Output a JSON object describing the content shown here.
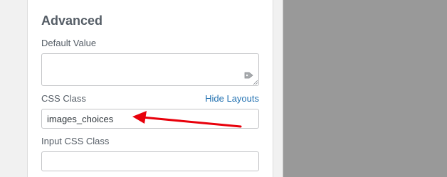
{
  "advanced": {
    "title": "Advanced",
    "default_value": {
      "label": "Default Value",
      "value": "",
      "icon": "tag-icon"
    },
    "css_class": {
      "label": "CSS Class",
      "value": "images_choices",
      "hide_layouts_link": "Hide Layouts"
    },
    "input_css_class": {
      "label": "Input CSS Class",
      "value": ""
    }
  },
  "colors": {
    "accent": "#2271b1",
    "annotation_arrow": "#e8000b",
    "overlay": "#999999"
  }
}
